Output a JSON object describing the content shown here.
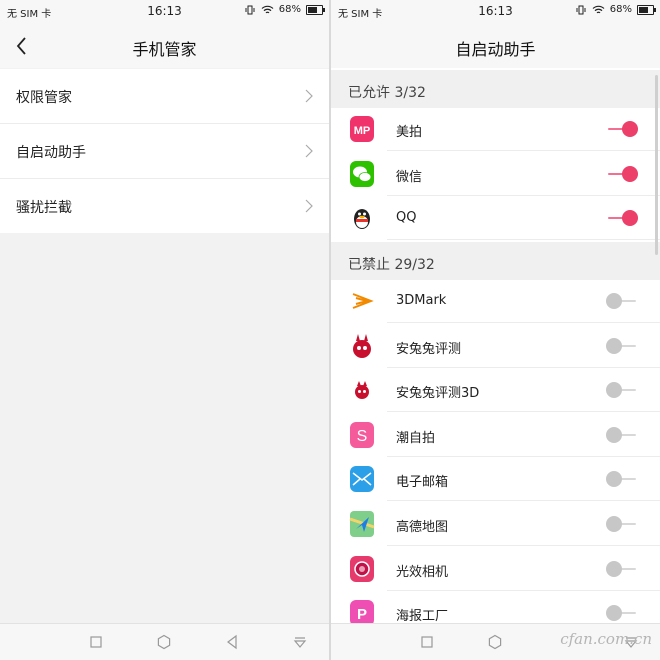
{
  "left": {
    "status": {
      "carrier": "无 SIM 卡",
      "time": "16:13",
      "battery": "68%",
      "battery_level": 0.68
    },
    "title": "手机管家",
    "menu_items": [
      {
        "label": "权限管家"
      },
      {
        "label": "自启动助手"
      },
      {
        "label": "骚扰拦截"
      }
    ]
  },
  "right": {
    "status": {
      "carrier": "无 SIM 卡",
      "time": "16:13",
      "battery": "68%",
      "battery_level": 0.68
    },
    "title": "自启动助手",
    "allowed_header": "已允许 3/32",
    "allowed_apps": [
      {
        "name": "美拍",
        "icon": "meipai-icon",
        "enabled": true
      },
      {
        "name": "微信",
        "icon": "wechat-icon",
        "enabled": true
      },
      {
        "name": "QQ",
        "icon": "qq-icon",
        "enabled": true
      }
    ],
    "blocked_header": "已禁止 29/32",
    "blocked_apps": [
      {
        "name": "3DMark",
        "icon": "3dmark-icon",
        "enabled": false
      },
      {
        "name": "安兔兔评测",
        "icon": "antutu-icon",
        "enabled": false
      },
      {
        "name": "安兔兔评测3D",
        "icon": "antutu-3d-icon",
        "enabled": false
      },
      {
        "name": "潮自拍",
        "icon": "chaozipai-icon",
        "enabled": false
      },
      {
        "name": "电子邮箱",
        "icon": "email-icon",
        "enabled": false
      },
      {
        "name": "高德地图",
        "icon": "amap-icon",
        "enabled": false
      },
      {
        "name": "光效相机",
        "icon": "camera-icon",
        "enabled": false
      },
      {
        "name": "海报工厂",
        "icon": "poster-icon",
        "enabled": false
      }
    ]
  },
  "watermark": "cfan.com.cn",
  "colors": {
    "toggle_on": "#ec3f6a",
    "toggle_off": "#c7c7c7"
  }
}
